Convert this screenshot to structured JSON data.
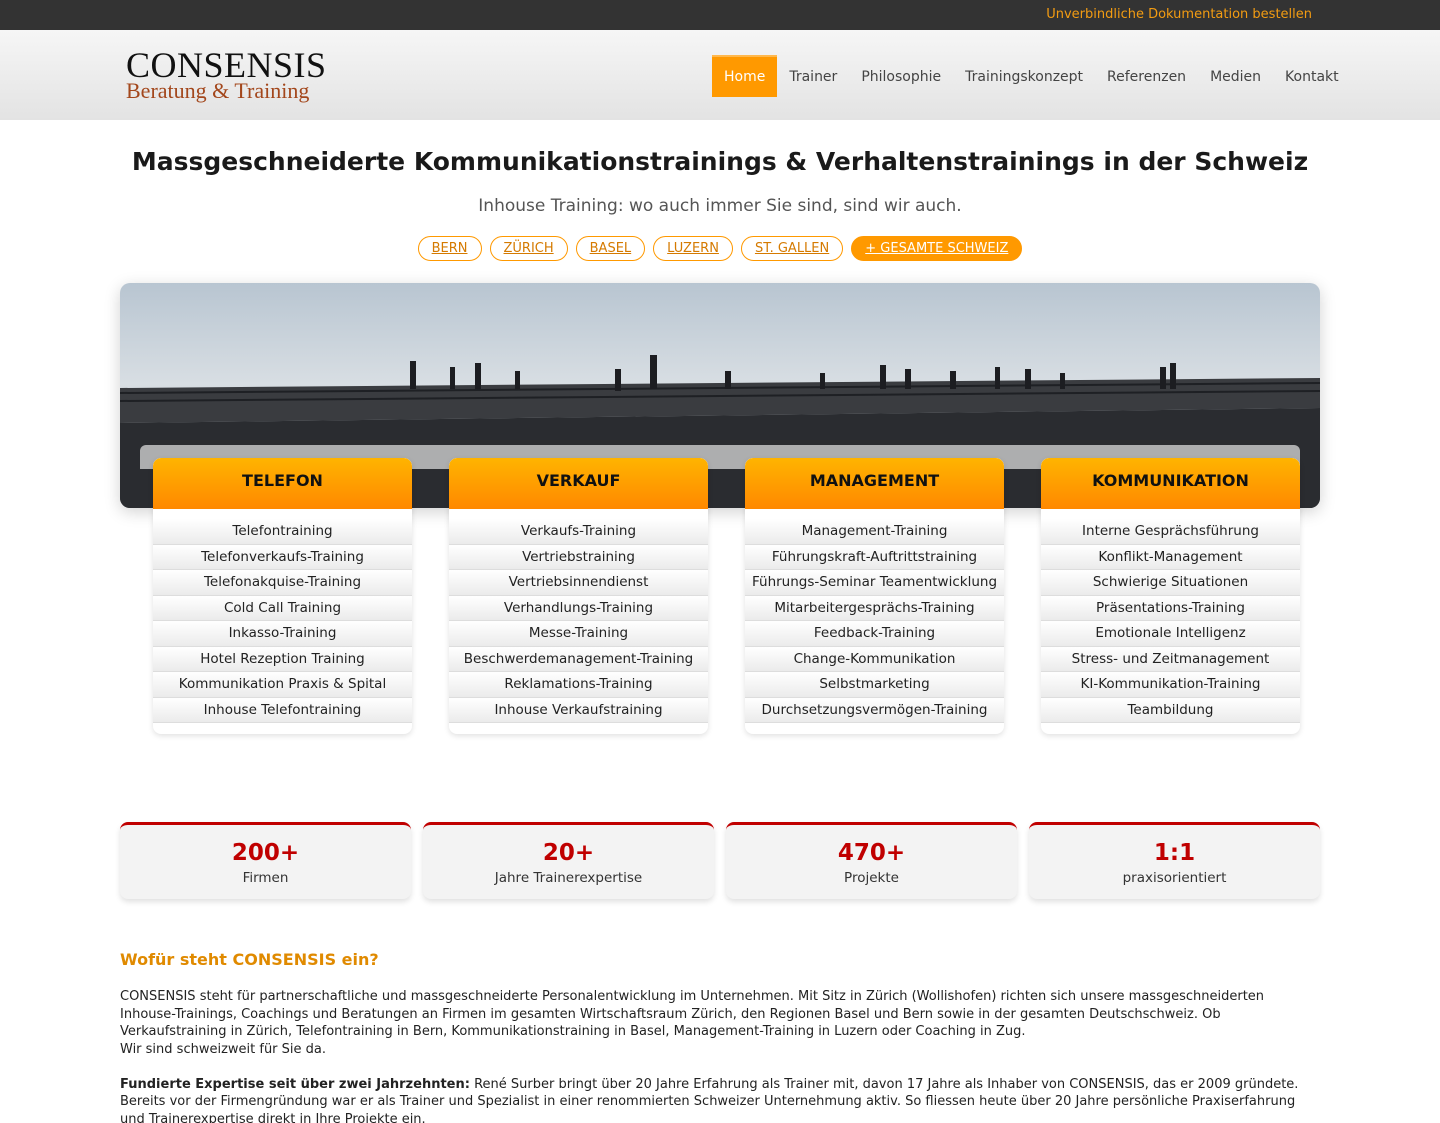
{
  "topbar": {
    "cta": "Unverbindliche Dokumentation bestellen"
  },
  "brand": {
    "line1": "CONSENSIS",
    "line2": "Beratung & Training"
  },
  "nav": {
    "items": [
      "Home",
      "Trainer",
      "Philosophie",
      "Trainingskonzept",
      "Referenzen",
      "Medien",
      "Kontakt"
    ],
    "active": "Home"
  },
  "hero": {
    "headline": "Massgeschneiderte Kommunikationstrainings & Verhaltenstrainings in der Schweiz",
    "subline": "Inhouse Training: wo auch immer Sie sind, sind wir auch."
  },
  "cities": [
    "BERN",
    "ZÜRICH",
    "BASEL",
    "LUZERN",
    "ST. GALLEN",
    "+ GESAMTE SCHWEIZ"
  ],
  "categories": [
    {
      "title": "TELEFON",
      "items": [
        "Telefontraining",
        "Telefonverkaufs-Training",
        "Telefonakquise-Training",
        "Cold Call Training",
        "Inkasso-Training",
        "Hotel Rezeption Training",
        "Kommunikation Praxis & Spital",
        "Inhouse Telefontraining"
      ]
    },
    {
      "title": "VERKAUF",
      "items": [
        "Verkaufs-Training",
        "Vertriebstraining",
        "Vertriebsinnendienst",
        "Verhandlungs-Training",
        "Messe-Training",
        "Beschwerdemanagement-Training",
        "Reklamations-Training",
        "Inhouse Verkaufstraining"
      ]
    },
    {
      "title": "MANAGEMENT",
      "items": [
        "Management-Training",
        "Führungskraft-Auftrittstraining",
        "Führungs-Seminar Teamentwicklung",
        "Mitarbeitergesprächs-Training",
        "Feedback-Training",
        "Change-Kommunikation",
        "Selbstmarketing",
        "Durchsetzungsvermögen-Training"
      ]
    },
    {
      "title": "KOMMUNIKATION",
      "items": [
        "Interne Gesprächsführung",
        "Konflikt-Management",
        "Schwierige Situationen",
        "Präsentations-Training",
        "Emotionale Intelligenz",
        "Stress- und Zeitmanagement",
        "KI-Kommunikation-Training",
        "Teambildung"
      ]
    }
  ],
  "stats": [
    {
      "value": "200+",
      "label": "Firmen"
    },
    {
      "value": "20+",
      "label": "Jahre Trainerexpertise"
    },
    {
      "value": "470+",
      "label": "Projekte"
    },
    {
      "value": "1:1",
      "label": "praxisorientiert"
    }
  ],
  "about": {
    "title": "Wofür steht CONSENSIS ein?",
    "p1": "CONSENSIS steht für partnerschaftliche und massgeschneiderte Personalentwicklung im Unternehmen. Mit Sitz in Zürich (Wollishofen) richten sich unsere massgeschneiderten Inhouse-Trainings, Coachings und Beratungen an Firmen im gesamten Wirtschaftsraum Zürich, den Regionen Basel und Bern sowie in der gesamten Deutschschweiz. Ob Verkaufstraining in Zürich, Telefontraining in Bern, Kommunikationstraining in Basel, Management-Training in Luzern oder Coaching in Zug.",
    "p1b": "Wir sind schweizweit für Sie da.",
    "p2_bold": "Fundierte Expertise seit über zwei Jahrzehnten:",
    "p2": " René Surber bringt über 20 Jahre Erfahrung als Trainer mit, davon 17 Jahre als Inhaber von CONSENSIS, das er 2009 gründete. Bereits vor der Firmengründung war er als Trainer und Spezialist in einer renommierten Schweizer Unternehmung aktiv. So fliessen heute über 20 Jahre persönliche Praxiserfahrung und Trainerexpertise direkt in Ihre Projekte ein."
  }
}
